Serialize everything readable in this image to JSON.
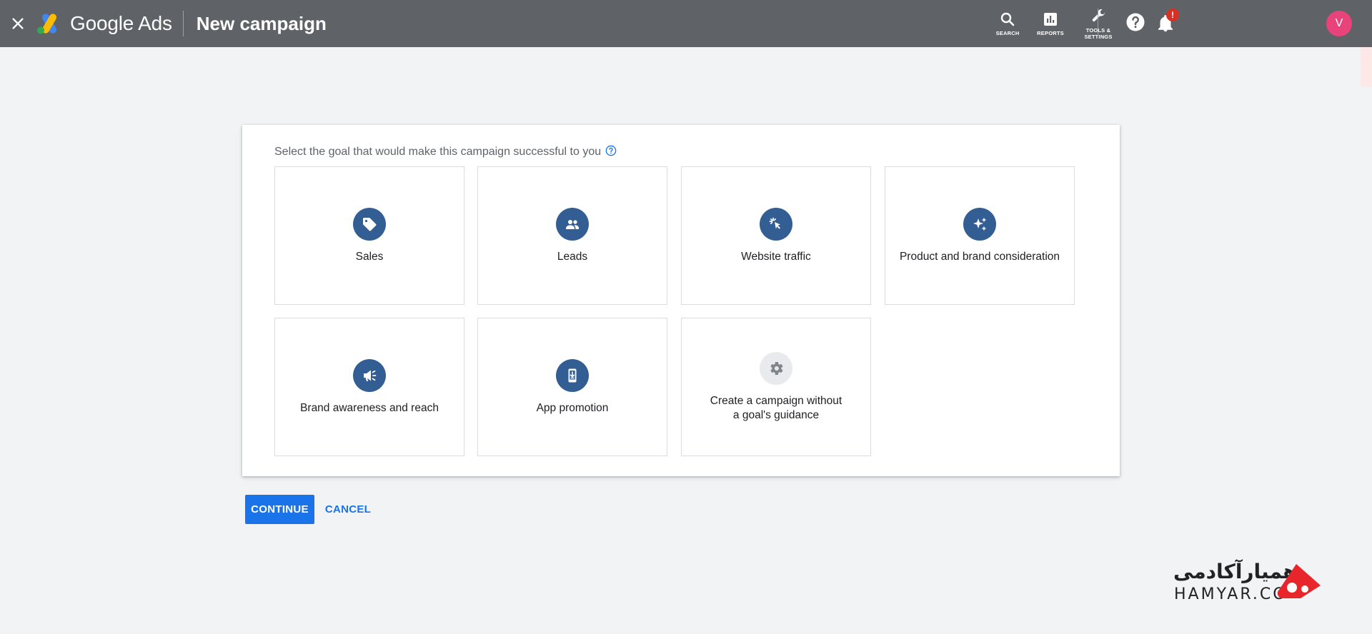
{
  "header": {
    "brand": "Google Ads",
    "title": "New campaign",
    "actions": {
      "search": "SEARCH",
      "reports": "REPORTS",
      "tools_line1": "TOOLS &",
      "tools_line2": "SETTINGS"
    },
    "notification_badge": "!",
    "avatar_letter": "V"
  },
  "main": {
    "prompt": "Select the goal that would make this campaign successful to you",
    "goals": [
      {
        "label": "Sales",
        "icon": "tag-icon"
      },
      {
        "label": "Leads",
        "icon": "people-icon"
      },
      {
        "label": "Website traffic",
        "icon": "cursor-click-icon"
      },
      {
        "label": "Product and brand consideration",
        "icon": "sparkle-icon"
      },
      {
        "label": "Brand awareness and reach",
        "icon": "megaphone-icon"
      },
      {
        "label": "App promotion",
        "icon": "phone-download-icon"
      },
      {
        "label": "Create a campaign without a goal's guidance",
        "icon": "gear-icon"
      }
    ]
  },
  "footer": {
    "continue": "CONTINUE",
    "cancel": "CANCEL"
  },
  "watermark": {
    "fa": "همیارآکادمی",
    "en": "HAMYAR.CO"
  },
  "colors": {
    "header_bg": "#5f6368",
    "icon_bg": "#335e94",
    "primary": "#1a73e8",
    "avatar": "#e8437a"
  }
}
